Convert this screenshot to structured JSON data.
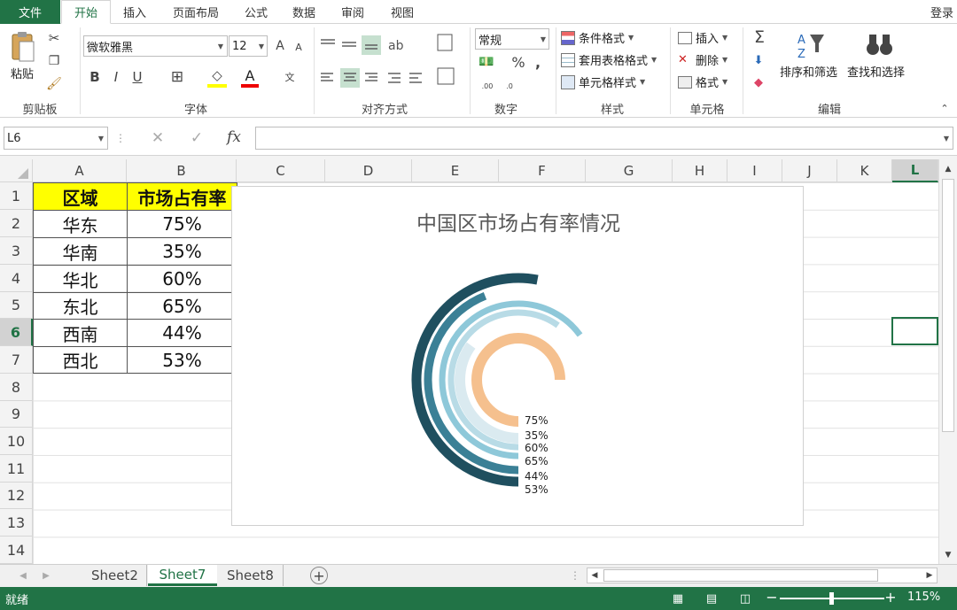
{
  "ribbon": {
    "file_tab": "文件",
    "tabs": [
      "开始",
      "插入",
      "页面布局",
      "公式",
      "数据",
      "审阅",
      "视图"
    ],
    "login": "登录",
    "clipboard": {
      "paste": "粘贴",
      "label": "剪贴板"
    },
    "font": {
      "name": "微软雅黑",
      "size": "12",
      "bold": "B",
      "italic": "I",
      "underline": "U",
      "font_color_glyph": "A",
      "grow": "A",
      "shrink": "A",
      "phonetic": "文",
      "label": "字体"
    },
    "alignment": {
      "label": "对齐方式"
    },
    "number": {
      "format": "常规",
      "percent": "%",
      "comma": ",",
      "inc": ".00",
      "dec": ".0",
      "label": "数字"
    },
    "styles": {
      "conditional": "条件格式",
      "table": "套用表格格式",
      "cell": "单元格样式",
      "label": "样式"
    },
    "cells": {
      "insert": "插入",
      "delete": "删除",
      "format": "格式",
      "label": "单元格"
    },
    "editing": {
      "sort": "排序和筛选",
      "find": "查找和选择",
      "label": "编辑"
    }
  },
  "formula_bar": {
    "name_box": "L6",
    "fx": "fx",
    "value": ""
  },
  "columns": [
    "A",
    "B",
    "C",
    "D",
    "E",
    "F",
    "G",
    "H",
    "I",
    "J",
    "K",
    "L"
  ],
  "rows": [
    "1",
    "2",
    "3",
    "4",
    "5",
    "6",
    "7",
    "8",
    "9",
    "10",
    "11",
    "12",
    "13",
    "14"
  ],
  "table": {
    "header": [
      "区域",
      "市场占有率"
    ],
    "rows": [
      [
        "华东",
        "75%"
      ],
      [
        "华南",
        "35%"
      ],
      [
        "华北",
        "60%"
      ],
      [
        "东北",
        "65%"
      ],
      [
        "西南",
        "44%"
      ],
      [
        "西北",
        "53%"
      ]
    ]
  },
  "chart_data": {
    "type": "radial-bar",
    "title": "中国区市场占有率情况",
    "categories": [
      "华东",
      "华南",
      "华北",
      "东北",
      "西南",
      "西北"
    ],
    "values": [
      75,
      35,
      60,
      65,
      44,
      53
    ],
    "labels": [
      "75%",
      "35%",
      "60%",
      "65%",
      "44%",
      "53%"
    ],
    "colors": [
      "#f5c08e",
      "#daeaf0",
      "#b8dbe6",
      "#8ec8d9",
      "#3b8096",
      "#1f4f5f"
    ]
  },
  "sheets": [
    "Sheet2",
    "Sheet7",
    "Sheet8"
  ],
  "active_sheet": "Sheet7",
  "status": {
    "ready": "就绪",
    "zoom": "115%",
    "minus": "−",
    "plus": "+"
  },
  "colors": {
    "excel_green": "#217346",
    "header_fill": "#ffff00",
    "selection": "#217346"
  }
}
